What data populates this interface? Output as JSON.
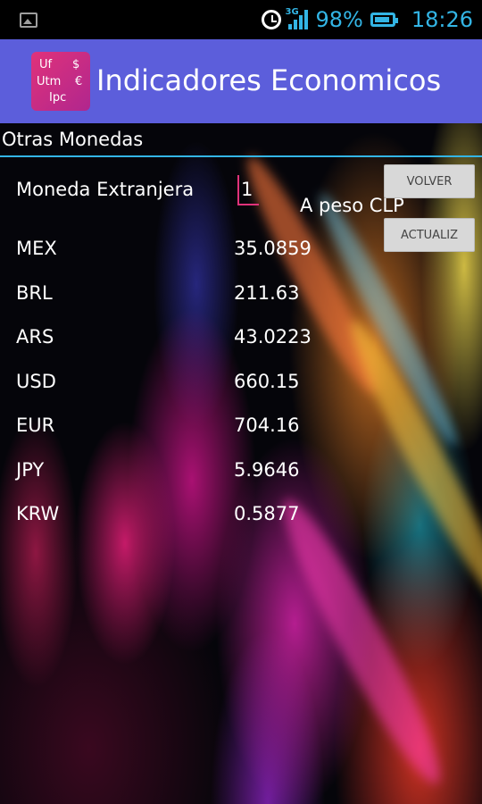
{
  "status_bar": {
    "network": "3G",
    "battery_percent": "98%",
    "time": "18:26"
  },
  "action_bar": {
    "app_icon_text": [
      "Uf",
      "$",
      "Utm",
      "€",
      "Ipc"
    ],
    "title": "Indicadores Economicos"
  },
  "screen": {
    "section_title": "Otras Monedas",
    "moneda_label": "Moneda Extranjera",
    "amount_value": "1",
    "conversion_label": "A peso CLP",
    "volver_button": "VOLVER",
    "actualiz_button": "ACTUALIZ"
  },
  "rates": [
    {
      "code": "MEX",
      "value": "35.0859"
    },
    {
      "code": "BRL",
      "value": "211.63"
    },
    {
      "code": "ARS",
      "value": "43.0223"
    },
    {
      "code": "USD",
      "value": "660.15"
    },
    {
      "code": "EUR",
      "value": "704.16"
    },
    {
      "code": "JPY",
      "value": "5.9646"
    },
    {
      "code": "KRW",
      "value": "0.5877"
    }
  ],
  "colors": {
    "accent": "#33b5e5",
    "action_bar": "#5c5edb",
    "input_underline": "#e0327a"
  }
}
